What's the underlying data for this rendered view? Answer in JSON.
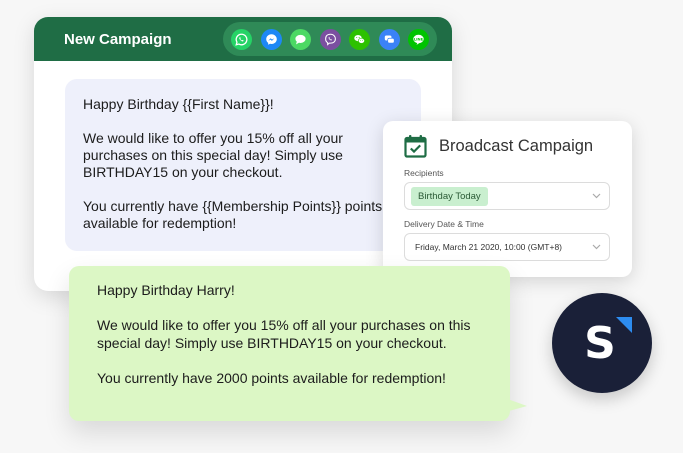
{
  "campaign": {
    "title": "New Campaign",
    "channels": [
      {
        "name": "whatsapp",
        "color": "#25d366"
      },
      {
        "name": "messenger",
        "color": "#1e88f5"
      },
      {
        "name": "sms",
        "color": "#4cd964"
      },
      {
        "name": "viber",
        "color": "#7b4fa0"
      },
      {
        "name": "wechat",
        "color": "#2dc100"
      },
      {
        "name": "telegram",
        "color": "#3b82f6"
      },
      {
        "name": "line",
        "color": "#00c300"
      }
    ],
    "template": {
      "greeting": "Happy Birthday {{First Name}}!",
      "offer": "We would like to offer you 15% off all your purchases on this special day! Simply use BIRTHDAY15 on your checkout.",
      "points": "You currently have {{Membership Points}} points available for redemption!"
    }
  },
  "broadcast": {
    "title": "Broadcast Campaign",
    "recipients_label": "Recipients",
    "recipients_value": "Birthday Today",
    "delivery_label": "Delivery Date & Time",
    "delivery_value": "Friday, March 21 2020, 10:00 (GMT+8)"
  },
  "preview": {
    "greeting": "Happy Birthday Harry!",
    "offer": "We would like to offer you 15% off all your purchases on this special day! Simply use BIRTHDAY15 on your checkout.",
    "points": "You currently have 2000 points available for redemption!"
  },
  "brand": {
    "letter": "S",
    "color": "#1a2038",
    "accent": "#2d8cf0"
  }
}
